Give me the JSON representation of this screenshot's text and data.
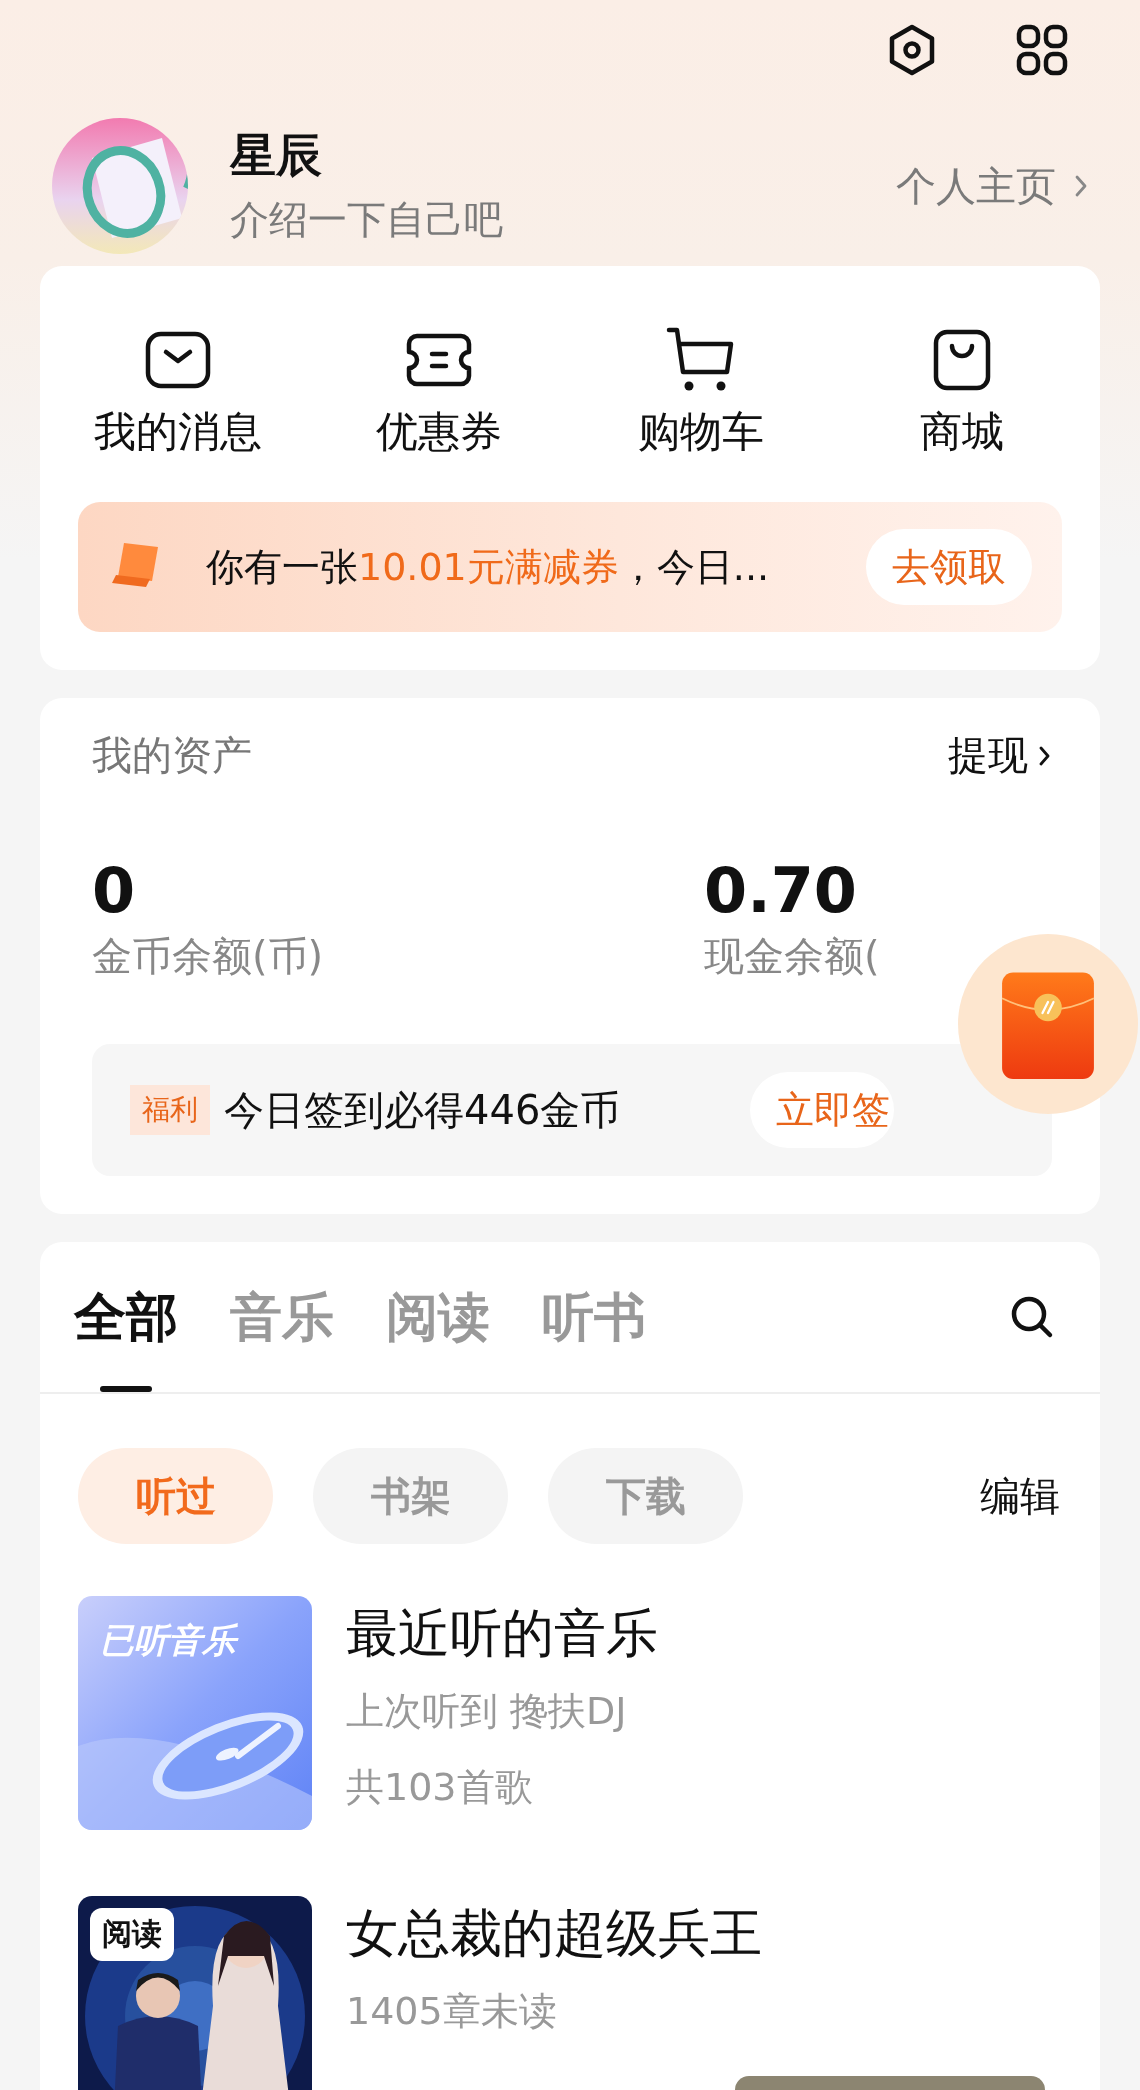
{
  "profile": {
    "name": "星辰",
    "bio": "介绍一下自己吧",
    "homepage_link": "个人主页"
  },
  "shortcuts": [
    {
      "label": "我的消息",
      "kind": "mail"
    },
    {
      "label": "优惠券",
      "kind": "ticket"
    },
    {
      "label": "购物车",
      "kind": "cart"
    },
    {
      "label": "商城",
      "kind": "bag"
    }
  ],
  "coupon_banner": {
    "text_before": "你有一张",
    "highlight": "10.01元满减券",
    "text_after": "，今日...",
    "button": "去领取"
  },
  "assets": {
    "title": "我的资产",
    "withdraw_link": "提现",
    "balances": [
      {
        "value": "0",
        "label": "金币余额(币)"
      },
      {
        "value": "0.70",
        "label": "现金余额("
      }
    ]
  },
  "welfare": {
    "tag": "福利",
    "text": "今日签到必得446金币",
    "button": "立即签"
  },
  "tabs": [
    {
      "label": "全部",
      "selected": true
    },
    {
      "label": "音乐",
      "selected": false
    },
    {
      "label": "阅读",
      "selected": false
    },
    {
      "label": "听书",
      "selected": false
    }
  ],
  "filters": [
    {
      "label": "听过",
      "selected": true
    },
    {
      "label": "书架",
      "selected": false
    },
    {
      "label": "下载",
      "selected": false
    }
  ],
  "edit_link": "编辑",
  "items": [
    {
      "kind": "music",
      "cover_label": "已听音乐",
      "title": "最近听的音乐",
      "lines": [
        "上次听到 搀扶DJ",
        "共103首歌"
      ]
    },
    {
      "kind": "book",
      "cover_badge": "阅读",
      "title": "女总裁的超级兵王",
      "lines": [
        "1405章未读"
      ]
    }
  ]
}
